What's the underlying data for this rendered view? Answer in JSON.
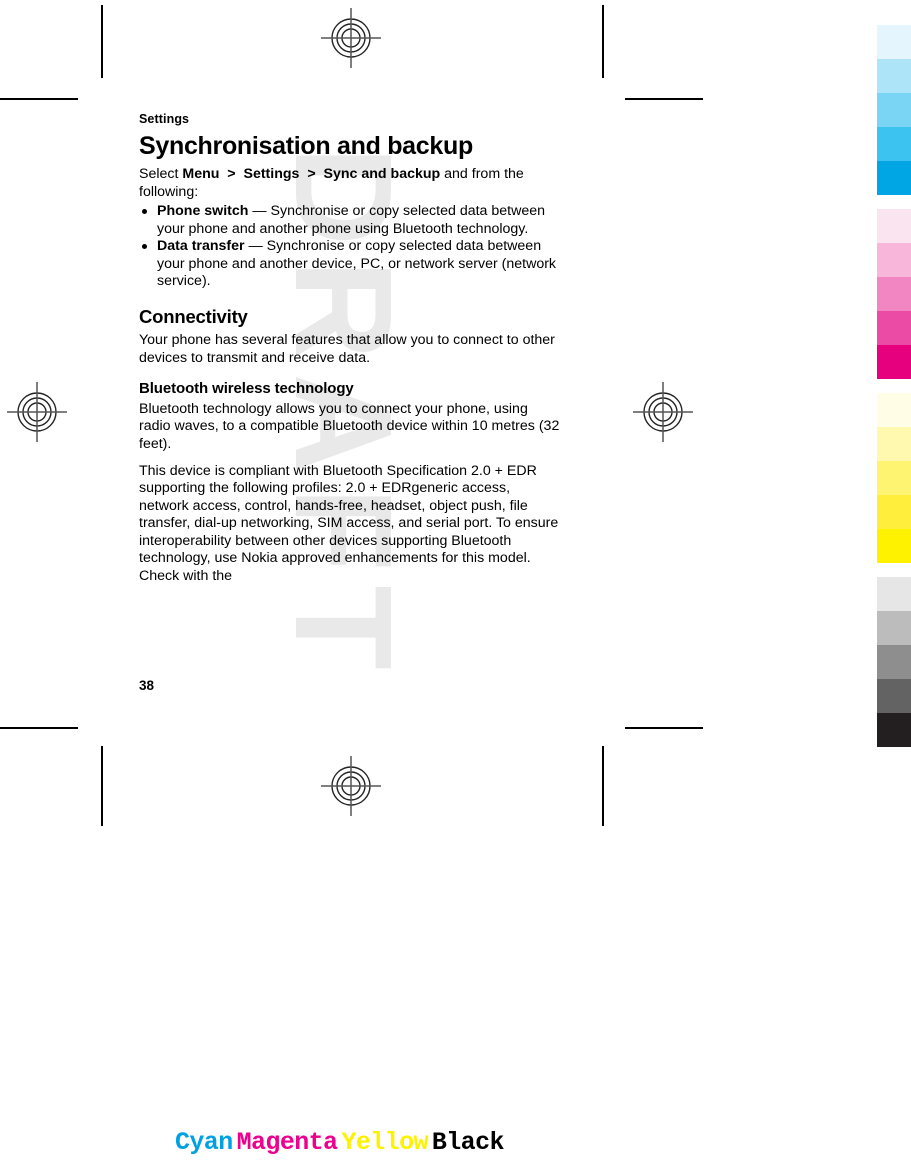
{
  "document": {
    "running_head": "Settings",
    "page_number": "38",
    "watermark": "DRAFT"
  },
  "content": {
    "chapter_title": "Synchronisation and backup",
    "intro": {
      "lead_plain_1": "Select ",
      "menu_path": [
        "Menu",
        "Settings",
        "Sync and backup"
      ],
      "separator": ">",
      "lead_plain_2": " and from the following:"
    },
    "bullets": [
      {
        "term": "Phone switch",
        "dash": "—",
        "description": "Synchronise or copy selected data between your phone and another phone using Bluetooth technology."
      },
      {
        "term": "Data transfer",
        "dash": "—",
        "description": "Synchronise or copy selected data between your phone and another device, PC, or network server (network service)."
      }
    ],
    "connectivity": {
      "title": "Connectivity",
      "paragraph": "Your phone has several features that allow you to connect to other devices to transmit and receive data."
    },
    "bluetooth": {
      "title": "Bluetooth wireless technology",
      "paragraph_1": "Bluetooth technology allows you to connect your phone, using radio waves, to a compatible Bluetooth device within 10 metres (32 feet).",
      "paragraph_2": "This device is compliant with Bluetooth Specification 2.0 + EDR supporting the following profiles: 2.0 + EDRgeneric access, network access, control, hands-free, headset, object push, file transfer, dial-up networking, SIM access, and serial port. To ensure interoperability between other devices supporting Bluetooth technology, use Nokia approved enhancements for this model. Check with the"
    }
  },
  "print_marks": {
    "cmyk_labels": [
      {
        "text": "Cyan",
        "color": "#00a0e3"
      },
      {
        "text": "Magenta",
        "color": "#ec008c"
      },
      {
        "text": "Yellow",
        "color": "#fff200"
      },
      {
        "text": "Black",
        "color": "#000000"
      }
    ],
    "color_bar": {
      "cyan": [
        "#e5f5fd",
        "#aee4f8",
        "#7ad4f4",
        "#3cc3ef",
        "#00a5e3"
      ],
      "magenta": [
        "#fae4f0",
        "#f7b6da",
        "#f286c3",
        "#ec4ba5",
        "#e6007e"
      ],
      "yellow": [
        "#fffde5",
        "#fff9b0",
        "#fff472",
        "#ffee3c",
        "#fff200"
      ],
      "black": [
        "#e6e6e6",
        "#bcbcbc",
        "#8e8e8e",
        "#636363",
        "#231f20"
      ]
    }
  }
}
